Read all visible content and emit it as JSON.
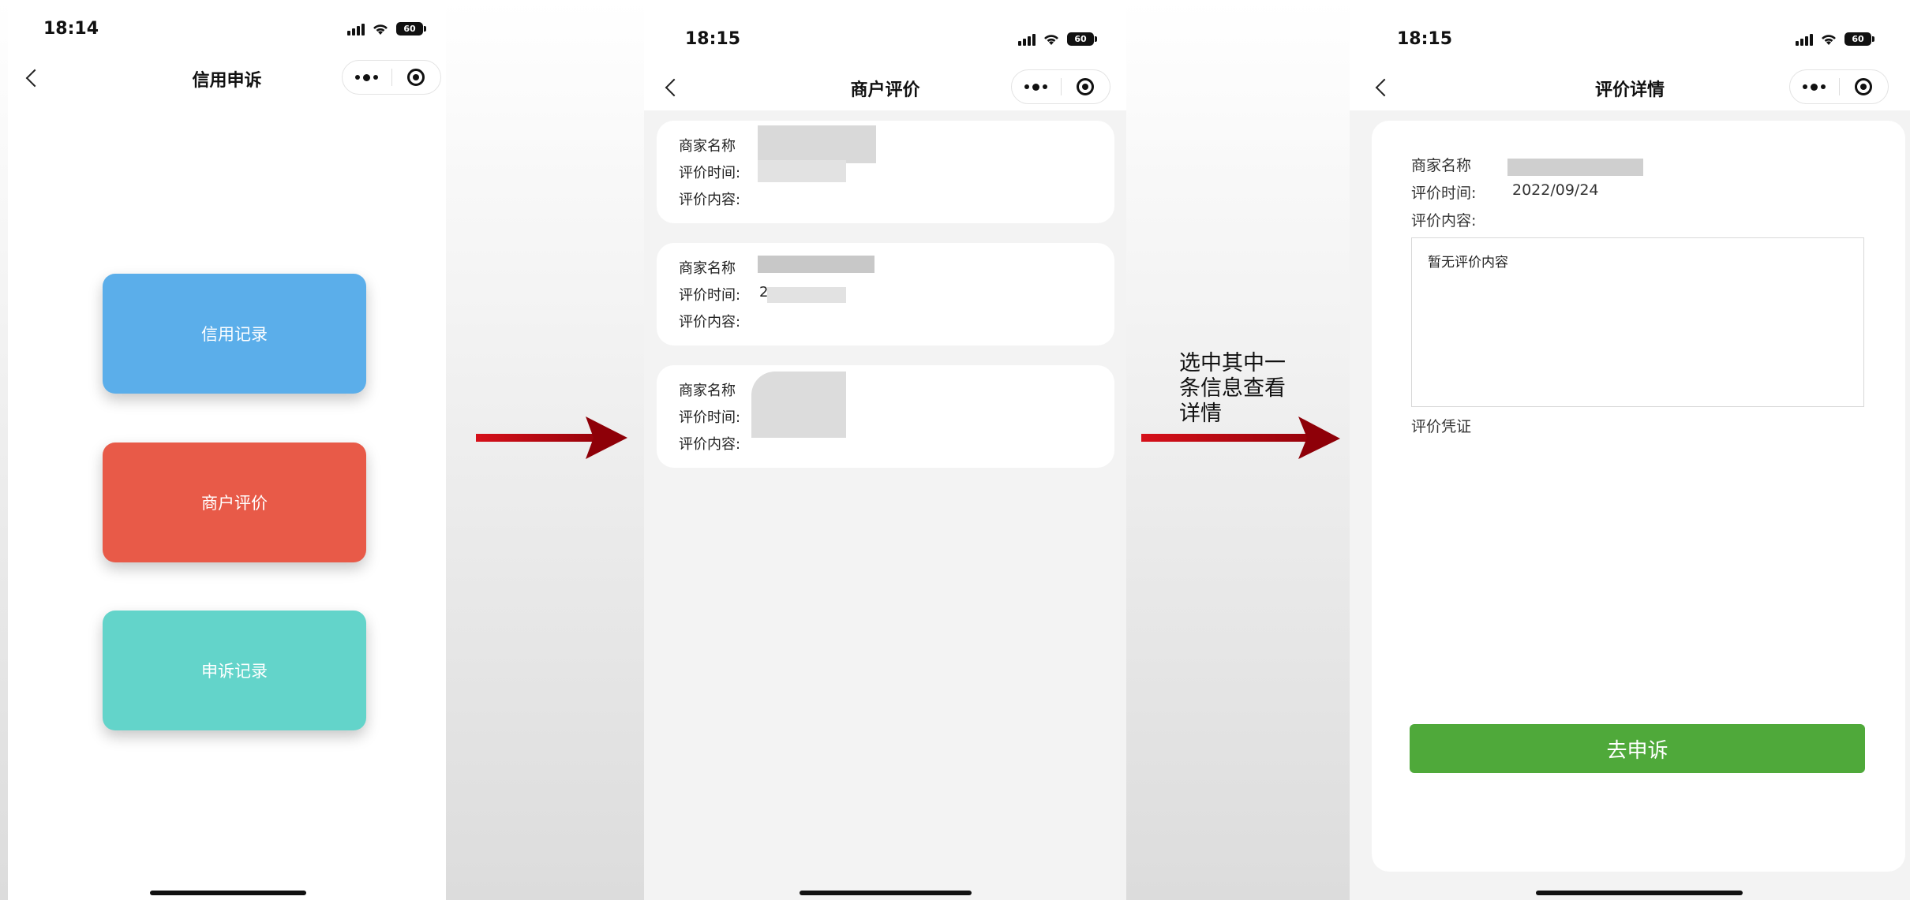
{
  "screen1": {
    "time": "18:14",
    "battery": "60",
    "title": "信用申诉",
    "buttons": [
      {
        "label": "信用记录",
        "color": "#5baeea"
      },
      {
        "label": "商户评价",
        "color": "#e85a48"
      },
      {
        "label": "申诉记录",
        "color": "#63d4ca"
      }
    ]
  },
  "screen2": {
    "time": "18:15",
    "battery": "60",
    "title": "商户评价",
    "cards": [
      {
        "merchant_label": "商家名称",
        "time_label": "评价时间:",
        "content_label": "评价内容:"
      },
      {
        "merchant_label": "商家名称",
        "time_label": "评价时间:",
        "time_value": "2",
        "content_label": "评价内容:"
      },
      {
        "merchant_label": "商家名称",
        "time_label": "评价时间:",
        "content_label": "评价内容:"
      }
    ]
  },
  "annotation": {
    "text_line1": "选中其中一",
    "text_line2": "条信息查看",
    "text_line3": "详情",
    "arrow_color": "#b0060e"
  },
  "screen3": {
    "time": "18:15",
    "battery": "60",
    "title": "评价详情",
    "merchant_label": "商家名称",
    "time_label": "评价时间:",
    "time_value": "2022/09/24",
    "content_label": "评价内容:",
    "content_value": "暂无评价内容",
    "proof_label": "评价凭证",
    "appeal_button": "去申诉",
    "appeal_color": "#4fa93a"
  }
}
